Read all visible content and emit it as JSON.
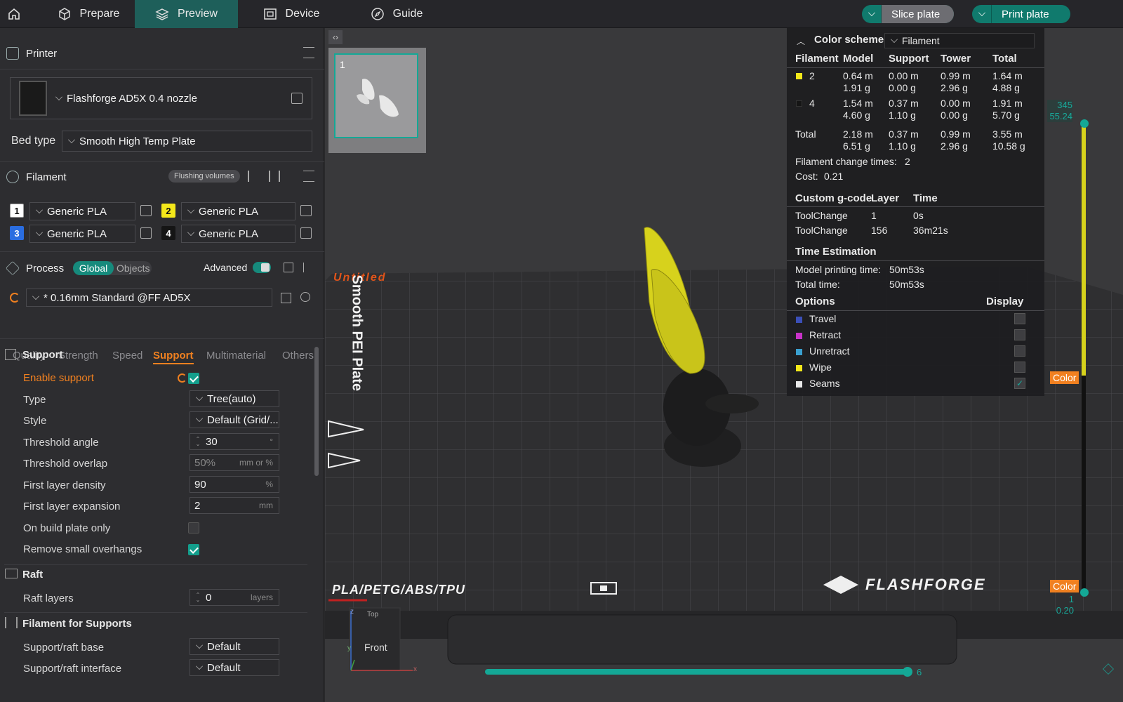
{
  "topbar": {
    "tabs": [
      {
        "label": "Prepare",
        "icon": "cube-icon"
      },
      {
        "label": "Preview",
        "icon": "layers-icon",
        "active": true
      },
      {
        "label": "Device",
        "icon": "device-icon"
      },
      {
        "label": "Guide",
        "icon": "compass-icon"
      }
    ],
    "slice_label": "Slice plate",
    "print_label": "Print plate"
  },
  "printer": {
    "section_title": "Printer",
    "name": "Flashforge AD5X 0.4 nozzle",
    "bed_label": "Bed type",
    "bed_value": "Smooth High Temp Plate"
  },
  "filament": {
    "section_title": "Filament",
    "flushing_label": "Flushing volumes",
    "slots": [
      {
        "num": "1",
        "name": "Generic PLA",
        "color": "#ffffff"
      },
      {
        "num": "2",
        "name": "Generic PLA",
        "color": "#f4e81a"
      },
      {
        "num": "3",
        "name": "Generic PLA",
        "color": "#2a6de0"
      },
      {
        "num": "4",
        "name": "Generic PLA",
        "color": "#151515"
      }
    ]
  },
  "process": {
    "section_title": "Process",
    "global_label": "Global",
    "objects_label": "Objects",
    "advanced_label": "Advanced",
    "preset": "* 0.16mm Standard @FF AD5X",
    "tabs": [
      "Quality",
      "Strength",
      "Speed",
      "Support",
      "Multimaterial",
      "Others"
    ],
    "active_tab": "Support"
  },
  "support": {
    "group_title": "Support",
    "enable_label": "Enable support",
    "type_label": "Type",
    "type_value": "Tree(auto)",
    "style_label": "Style",
    "style_value": "Default (Grid/...",
    "threshold_angle_label": "Threshold angle",
    "threshold_angle_value": "30",
    "threshold_angle_unit": "°",
    "threshold_overlap_label": "Threshold overlap",
    "threshold_overlap_value": "50%",
    "threshold_overlap_unit": "mm or %",
    "first_layer_density_label": "First layer density",
    "first_layer_density_value": "90",
    "first_layer_density_unit": "%",
    "first_layer_expansion_label": "First layer expansion",
    "first_layer_expansion_value": "2",
    "first_layer_expansion_unit": "mm",
    "build_plate_only_label": "On build plate only",
    "remove_small_label": "Remove small overhangs",
    "raft_title": "Raft",
    "raft_layers_label": "Raft layers",
    "raft_layers_value": "0",
    "raft_layers_unit": "layers",
    "filament_supports_title": "Filament for Supports",
    "raft_base_label": "Support/raft base",
    "raft_base_value": "Default",
    "raft_interface_label": "Support/raft interface",
    "raft_interface_value": "Default"
  },
  "viewport": {
    "plate_number": "1",
    "plate_title": "Untitled",
    "plate_side_text": "Smooth PEI Plate",
    "material_text": "PLA/PETG/ABS/TPU",
    "brand_text": "FLASHFORGE",
    "cube_top": "Top",
    "cube_front": "Front",
    "axis_z": "z",
    "axis_y": "y",
    "axis_x": "x",
    "bottom_slider_value": "6"
  },
  "legend": {
    "color_scheme_label": "Color scheme",
    "color_scheme_value": "Filament",
    "headers": [
      "Filament",
      "Model",
      "Support",
      "Tower",
      "Total"
    ],
    "rows": [
      {
        "id": "2",
        "color": "#f4e81a",
        "model": [
          "0.64 m",
          "1.91 g"
        ],
        "support": [
          "0.00 m",
          "0.00 g"
        ],
        "tower": [
          "0.99 m",
          "2.96 g"
        ],
        "total": [
          "1.64 m",
          "4.88 g"
        ]
      },
      {
        "id": "4",
        "color": "#151515",
        "model": [
          "1.54 m",
          "4.60 g"
        ],
        "support": [
          "0.37 m",
          "1.10 g"
        ],
        "tower": [
          "0.00 m",
          "0.00 g"
        ],
        "total": [
          "1.91 m",
          "5.70 g"
        ]
      }
    ],
    "total_row": {
      "label": "Total",
      "model": [
        "2.18 m",
        "6.51 g"
      ],
      "support": [
        "0.37 m",
        "1.10 g"
      ],
      "tower": [
        "0.99 m",
        "2.96 g"
      ],
      "total": [
        "3.55 m",
        "10.58 g"
      ]
    },
    "change_times_label": "Filament change times:",
    "change_times_value": "2",
    "cost_label": "Cost:",
    "cost_value": "0.21",
    "gcode_headers": [
      "Custom g-code",
      "Layer",
      "Time"
    ],
    "gcode_rows": [
      {
        "name": "ToolChange",
        "layer": "1",
        "time": "0s"
      },
      {
        "name": "ToolChange",
        "layer": "156",
        "time": "36m21s"
      }
    ],
    "time_title": "Time Estimation",
    "model_time_label": "Model printing time:",
    "model_time_value": "50m53s",
    "total_time_label": "Total time:",
    "total_time_value": "50m53s",
    "options_label": "Options",
    "display_label": "Display",
    "options": [
      {
        "name": "Travel",
        "color": "#3b4fb8",
        "checked": false
      },
      {
        "name": "Retract",
        "color": "#c832c8",
        "checked": false
      },
      {
        "name": "Unretract",
        "color": "#3aa0d0",
        "checked": false
      },
      {
        "name": "Wipe",
        "color": "#f4e81a",
        "checked": false
      },
      {
        "name": "Seams",
        "color": "#e8e8e8",
        "checked": true
      }
    ]
  },
  "layer_slider": {
    "top_layer": "345",
    "top_height": "55.24",
    "bottom_layer": "1",
    "bottom_height": "0.20",
    "color_tag": "Color"
  }
}
